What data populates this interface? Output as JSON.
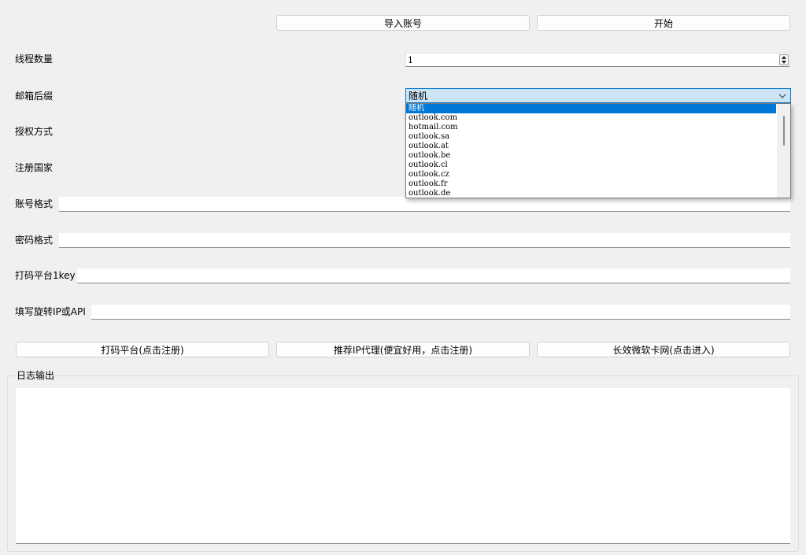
{
  "buttons": {
    "import_accounts": "导入账号",
    "start": "开始",
    "captcha_platform": "打码平台(点击注册)",
    "recommend_proxy": "推荐IP代理(便宜好用，点击注册)",
    "microsoft_card_site": "长效微软卡网(点击进入)"
  },
  "form": {
    "thread_count": {
      "label": "线程数量",
      "value": "1"
    },
    "email_suffix": {
      "label": "邮箱后缀",
      "value": "随机",
      "dropdown_open": true,
      "options": [
        "随机",
        "outlook.com",
        "hotmail.com",
        "outlook.sa",
        "outlook.at",
        "outlook.be",
        "outlook.cl",
        "outlook.cz",
        "outlook.fr",
        "outlook.de"
      ],
      "selected_index": 0
    },
    "auth_method": {
      "label": "授权方式"
    },
    "register_country": {
      "label": "注册国家"
    },
    "account_format": {
      "label": "账号格式",
      "value": ""
    },
    "password_format": {
      "label": "密码格式",
      "value": ""
    },
    "captcha_key": {
      "label": "打码平台1key",
      "value": ""
    },
    "rotating_ip": {
      "label": "填写旋转IP或API",
      "value": ""
    }
  },
  "log": {
    "title": "日志输出",
    "content": ""
  },
  "icons": {
    "spin_up": "spin-up-arrow-icon",
    "spin_down": "spin-down-arrow-icon",
    "combo_arrow": "chevron-down-icon"
  },
  "colors": {
    "window_bg": "#f0f0f0",
    "selection": "#0078d7",
    "combo_focus_bg": "#cce4f7",
    "combo_focus_border": "#0078d4"
  }
}
